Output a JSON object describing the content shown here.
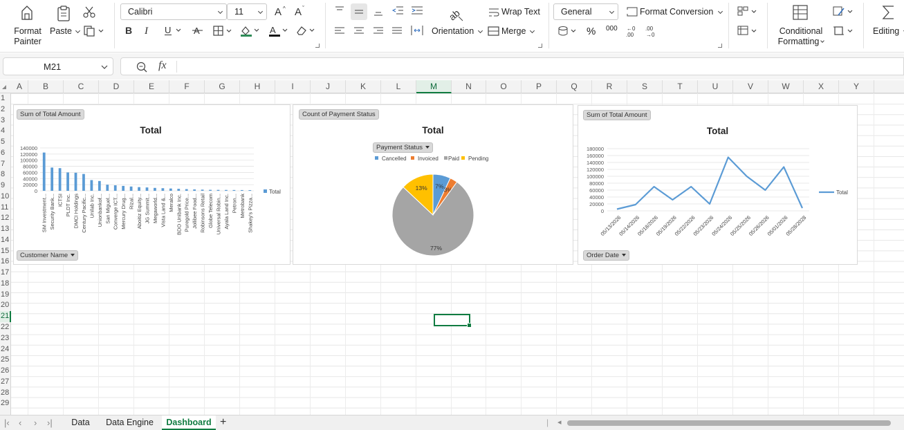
{
  "ribbon": {
    "format_painter": "Format Painter",
    "format_painter_l1": "Format",
    "format_painter_l2": "Painter",
    "paste": "Paste",
    "font_name": "Calibri",
    "font_size": "11",
    "wrap_text": "Wrap Text",
    "orientation": "Orientation",
    "merge": "Merge",
    "number_format": "General",
    "format_conversion": "Format Conversion",
    "conditional_l1": "Conditional",
    "conditional_l2": "Formatting",
    "editing": "Editing",
    "percent_symbol": "%",
    "thousands_symbol": "000",
    "fx_label": "fx"
  },
  "formula_bar": {
    "cell_ref": "M21",
    "formula": ""
  },
  "grid": {
    "columns": [
      "A",
      "B",
      "C",
      "D",
      "E",
      "F",
      "G",
      "H",
      "I",
      "J",
      "K",
      "L",
      "M",
      "N",
      "O",
      "P",
      "Q",
      "R",
      "S",
      "T",
      "U",
      "V",
      "W",
      "X",
      "Y"
    ],
    "selected_column": "M",
    "rows": [
      "1",
      "2",
      "3",
      "4",
      "5",
      "6",
      "7",
      "8",
      "9",
      "10",
      "11",
      "12",
      "13",
      "14",
      "15",
      "16",
      "17",
      "18",
      "19",
      "20",
      "21",
      "22",
      "23",
      "24",
      "25",
      "26",
      "27",
      "28",
      "29"
    ],
    "selected_row": "21"
  },
  "charts": {
    "bar": {
      "field_button": "Sum of Total Amount",
      "filter_button": "Customer Name",
      "legend": "Total"
    },
    "pie": {
      "field_button": "Count of Payment Status",
      "filter_button": "Payment Status",
      "legend_label_cancelled": "Cancelled",
      "legend_label_invoiced": "Invoiced",
      "legend_label_paid": "Paid",
      "legend_label_pending": "Pending",
      "label_paid": "77%",
      "label_pending": "13%",
      "label_cancelled": "7%",
      "label_invoiced": "3%"
    },
    "line": {
      "field_button": "Sum of Total Amount",
      "filter_button": "Order Date",
      "legend": "Total"
    }
  },
  "chart_data": [
    {
      "type": "bar",
      "title": "Total",
      "xlabel": "",
      "ylabel": "",
      "ylim": [
        0,
        140000
      ],
      "yticks": [
        0,
        20000,
        40000,
        60000,
        80000,
        100000,
        120000,
        140000
      ],
      "color": "#5b9bd5",
      "legend": "right",
      "grid": true,
      "categories": [
        "SM Investment...",
        "Security Bank...",
        "ICTSI",
        "PLDT Inc.",
        "DMCI Holdings",
        "Century Pacific...",
        "Unilab Inc.",
        "Unionbankof...",
        "San Miguel...",
        "Converge ICT...",
        "Mercury Drug...",
        "Rizal...",
        "Aboitiz Equity...",
        "JG Summit...",
        "Megaworld...",
        "Vista Land &...",
        "Meralco",
        "BDO Unibank Inc.",
        "Puregold Price...",
        "Jollibee Food...",
        "Robinsons Retail",
        "Globe Telecom",
        "Universal Robin...",
        "Ayala Land Inc.",
        "Petron...",
        "Metrobank",
        "Shakey's Pizza..."
      ],
      "series": [
        {
          "name": "Total",
          "values": [
            125000,
            76000,
            74000,
            60000,
            59000,
            55000,
            35000,
            32000,
            20000,
            18000,
            16000,
            14000,
            12000,
            11000,
            9500,
            8500,
            7500,
            6500,
            5500,
            4500,
            3800,
            3200,
            3000,
            2800,
            2600,
            2400,
            2200
          ]
        }
      ]
    },
    {
      "type": "pie",
      "title": "Total",
      "legend": "top",
      "categories": [
        "Cancelled",
        "Invoiced",
        "Paid",
        "Pending"
      ],
      "colors": [
        "#5b9bd5",
        "#ed7d31",
        "#a5a5a5",
        "#ffc000"
      ],
      "series": [
        {
          "name": "Total",
          "values": [
            7,
            3,
            77,
            13
          ]
        }
      ]
    },
    {
      "type": "line",
      "title": "Total",
      "xlabel": "",
      "ylabel": "",
      "ylim": [
        0,
        180000
      ],
      "yticks": [
        0,
        20000,
        40000,
        60000,
        80000,
        100000,
        120000,
        140000,
        160000,
        180000
      ],
      "color": "#5b9bd5",
      "legend": "right",
      "grid": true,
      "x": [
        "05/13/2026",
        "05/14/2026",
        "05/18/2026",
        "05/19/2026",
        "05/22/2026",
        "05/23/2026",
        "05/24/2026",
        "05/25/2026",
        "05/26/2026",
        "05/01/2026",
        "05/28/2028"
      ],
      "series": [
        {
          "name": "Total",
          "values": [
            5000,
            18000,
            70000,
            32000,
            70000,
            20000,
            155000,
            100000,
            60000,
            127000,
            8000
          ]
        }
      ]
    }
  ],
  "sheet_tabs": {
    "tabs": [
      "Data",
      "Data Engine",
      "Dashboard"
    ],
    "active": "Dashboard",
    "add_label": "+"
  }
}
